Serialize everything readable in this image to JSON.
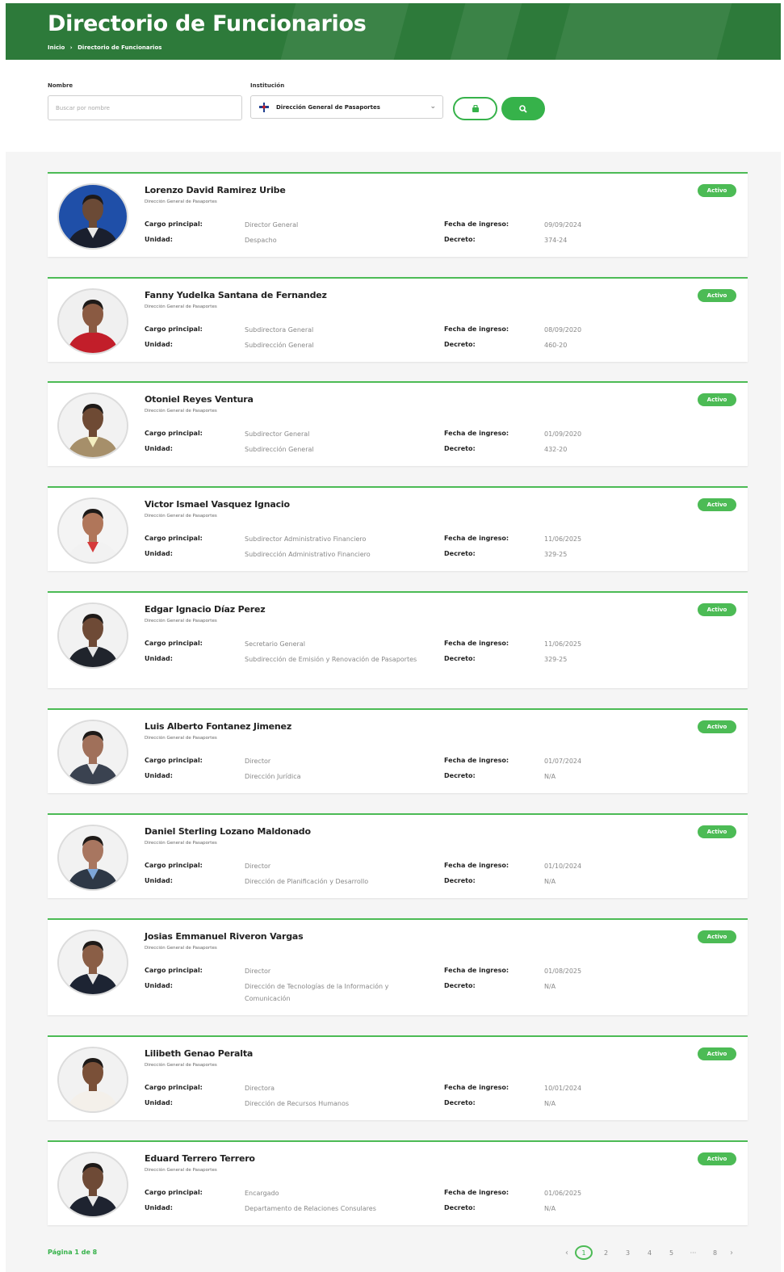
{
  "header": {
    "title": "Directorio de Funcionarios",
    "breadcrumb": [
      "Inicio",
      "›",
      "Directorio de Funcionarios"
    ]
  },
  "filters": {
    "name_label": "Nombre",
    "name_placeholder": "Buscar por nombre",
    "institution_label": "Institución",
    "institution_value": "Dirección General de Pasaportes",
    "clear_icon": "eraser-icon",
    "search_icon": "search-icon"
  },
  "labels": {
    "cargo": "Cargo principal:",
    "unidad": "Unidad:",
    "fecha": "Fecha de ingreso:",
    "decreto": "Decreto:"
  },
  "officials": [
    {
      "name": "Lorenzo David Ramirez Uribe",
      "institution": "Dirección General de Pasaportes",
      "status": "Activo",
      "cargo": "Director General",
      "unidad": "Despacho",
      "fecha": "09/09/2024",
      "decreto": "374-24",
      "avatar_bg": "#1f4fa8",
      "skin": "#6b4a36",
      "suit": "#1a1f2e",
      "shirt": "#e8e8e8"
    },
    {
      "name": "Fanny Yudelka Santana de Fernandez",
      "institution": "Dirección General de Pasaportes",
      "status": "Activo",
      "cargo": "Subdirectora General",
      "unidad": "Subdirección General",
      "fecha": "08/09/2020",
      "decreto": "460-20",
      "avatar_bg": "#f0f0f0",
      "skin": "#8a5a42",
      "suit": "#c21e2a",
      "shirt": "#c21e2a"
    },
    {
      "name": "Otoniel Reyes Ventura",
      "institution": "Dirección General de Pasaportes",
      "status": "Activo",
      "cargo": "Subdirector General",
      "unidad": "Subdirección General",
      "fecha": "01/09/2020",
      "decreto": "432-20",
      "avatar_bg": "#f2f2f2",
      "skin": "#6e4a34",
      "suit": "#a68f6a",
      "shirt": "#f3eec0"
    },
    {
      "name": "Victor Ismael Vasquez Ignacio",
      "institution": "Dirección General de Pasaportes",
      "status": "Activo",
      "cargo": "Subdirector Administrativo Financiero",
      "unidad": "Subdirección Administrativo Financiero",
      "fecha": "11/06/2025",
      "decreto": "329-25",
      "avatar_bg": "#f4f4f4",
      "skin": "#b0765a",
      "suit": "#f2f2f2",
      "shirt": "#d63a3a"
    },
    {
      "name": "Edgar Ignacio Díaz Perez",
      "institution": "Dirección General de Pasaportes",
      "status": "Activo",
      "cargo": "Secretario General",
      "unidad": "Subdirección de Emisión y Renovación de Pasaportes",
      "fecha": "11/06/2025",
      "decreto": "329-25",
      "avatar_bg": "#f2f2f2",
      "skin": "#6e4a36",
      "suit": "#20242c",
      "shirt": "#e6e6e6"
    },
    {
      "name": "Luis Alberto Fontanez Jimenez",
      "institution": "Dirección General de Pasaportes",
      "status": "Activo",
      "cargo": "Director",
      "unidad": "Dirección Jurídica",
      "fecha": "01/07/2024",
      "decreto": "N/A",
      "avatar_bg": "#f2f2f2",
      "skin": "#a0705a",
      "suit": "#3a4250",
      "shirt": "#e8e8e8"
    },
    {
      "name": "Daniel Sterling Lozano Maldonado",
      "institution": "Dirección General de Pasaportes",
      "status": "Activo",
      "cargo": "Director",
      "unidad": "Dirección de Planificación y Desarrollo",
      "fecha": "01/10/2024",
      "decreto": "N/A",
      "avatar_bg": "#f2f2f2",
      "skin": "#a87660",
      "suit": "#2e3846",
      "shirt": "#7ea6d8"
    },
    {
      "name": "Josias Emmanuel Riveron Vargas",
      "institution": "Dirección General de Pasaportes",
      "status": "Activo",
      "cargo": "Director",
      "unidad": "Dirección de Tecnologías de la Información y Comunicación",
      "fecha": "01/08/2025",
      "decreto": "N/A",
      "avatar_bg": "#f2f2f2",
      "skin": "#8a5e46",
      "suit": "#1d2433",
      "shirt": "#e8e8e8"
    },
    {
      "name": "Lilibeth Genao Peralta",
      "institution": "Dirección General de Pasaportes",
      "status": "Activo",
      "cargo": "Directora",
      "unidad": "Dirección de Recursos Humanos",
      "fecha": "10/01/2024",
      "decreto": "N/A",
      "avatar_bg": "#f2f2f2",
      "skin": "#7a5038",
      "suit": "#f4f0ea",
      "shirt": "#f4f0ea"
    },
    {
      "name": "Eduard Terrero Terrero",
      "institution": "Dirección General de Pasaportes",
      "status": "Activo",
      "cargo": "Encargado",
      "unidad": "Departamento de Relaciones Consulares",
      "fecha": "01/06/2025",
      "decreto": "N/A",
      "avatar_bg": "#f2f2f2",
      "skin": "#6e4a36",
      "suit": "#1e2330",
      "shirt": "#e8e8e8"
    }
  ],
  "pagination": {
    "summary": "Página 1 de 8",
    "prev": "‹",
    "pages": [
      "1",
      "2",
      "3",
      "4",
      "5",
      "···",
      "8"
    ],
    "next": "›",
    "current": "1"
  }
}
